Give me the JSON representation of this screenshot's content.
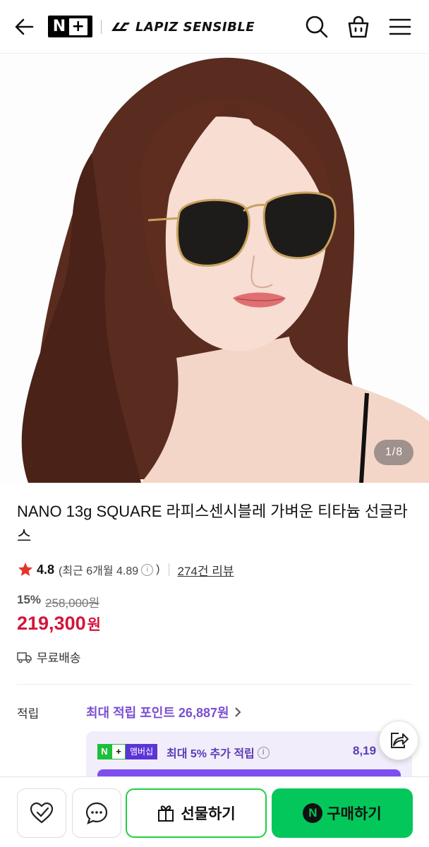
{
  "header": {
    "logo_n": "N",
    "logo_plus": "+",
    "brand_name": "LAPIZ SENSIBLE"
  },
  "image": {
    "counter_current": "1",
    "counter_sep": "/",
    "counter_total": "8"
  },
  "product": {
    "title": "NANO 13g SQUARE 라피스센시블레 가벼운 티타늄 선글라스",
    "rating": "4.8",
    "recent_rating_prefix": "(최근 6개월 4.89",
    "recent_rating_suffix": ")",
    "review_count": "274건 리뷰",
    "discount_rate": "15%",
    "original_price": "258,000원",
    "sale_price": "219,300",
    "sale_unit": "원",
    "shipping": "무료배송"
  },
  "points": {
    "label": "적립",
    "max_points": "최대 적립 포인트 26,887원",
    "member_badge_n": "N",
    "member_badge_plus": "+",
    "member_badge_text": "멤버십",
    "member_text": "최대 5% 추가 적립",
    "member_amount": "8,19"
  },
  "actions": {
    "gift": "선물하기",
    "buy_n": "N",
    "buy": "구매하기"
  },
  "colors": {
    "accent_green": "#03c75a",
    "price_red": "#d3153a",
    "points_purple": "#7a4fd1"
  }
}
